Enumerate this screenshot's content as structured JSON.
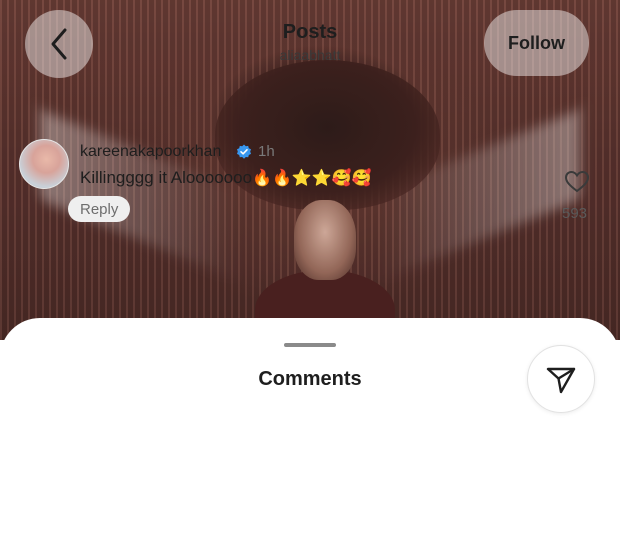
{
  "header": {
    "title": "Posts",
    "username": "aliaabhatt",
    "follow_label": "Follow",
    "back_icon": "chevron-left-icon"
  },
  "sheet": {
    "title": "Comments",
    "share_icon": "send-icon"
  },
  "comment": {
    "username": "kareenakapoorkhan",
    "verified": true,
    "time": "1h",
    "text": "Killingggg it Alooooooo",
    "emojis": "🔥🔥⭐⭐🥰🥰",
    "reply_label": "Reply",
    "likes": "593"
  },
  "colors": {
    "verified_blue": "#3897f0",
    "text_primary": "#1e1e1e",
    "text_secondary": "#7a7a7a"
  }
}
